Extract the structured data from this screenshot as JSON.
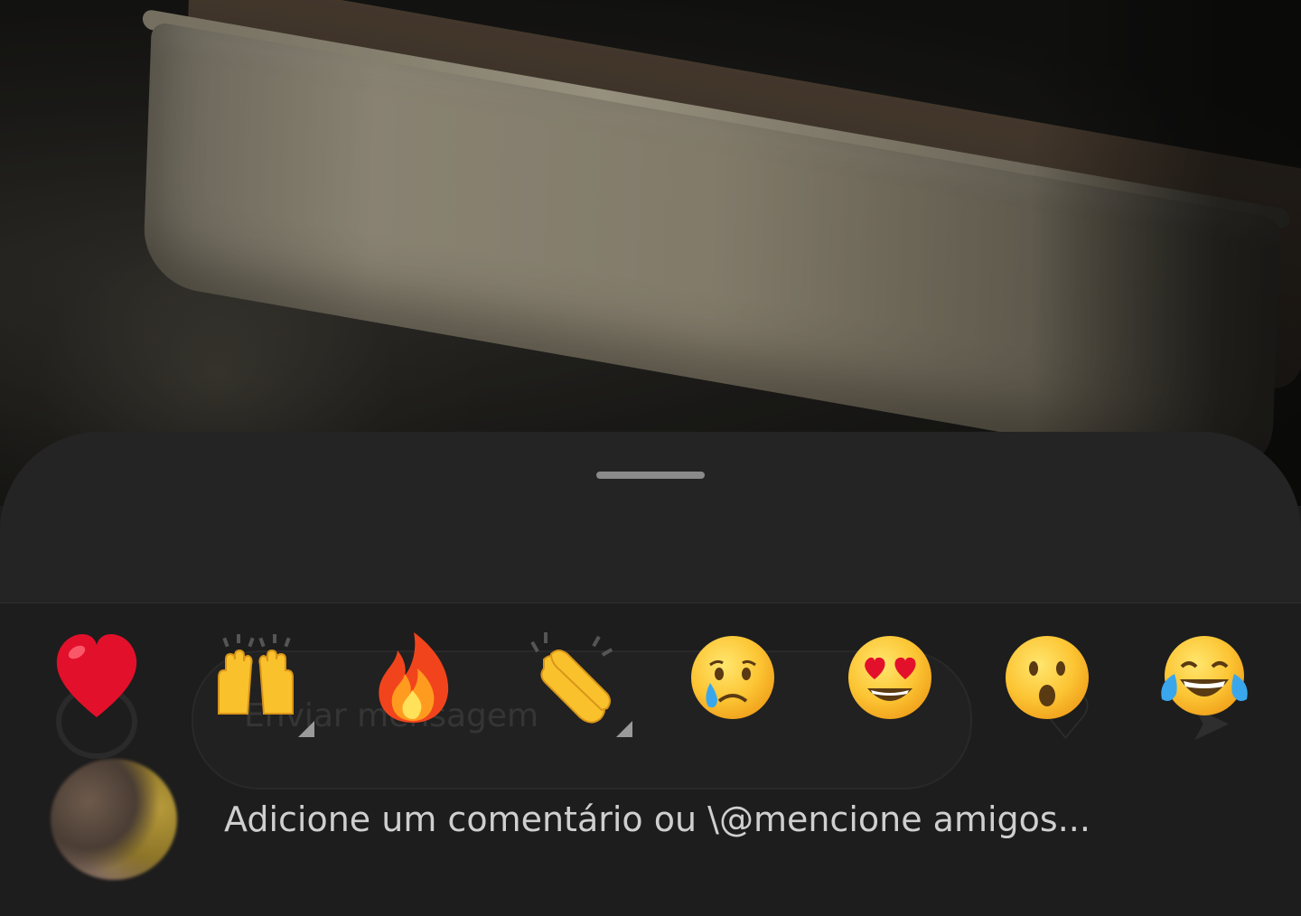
{
  "background": {
    "ghost_input_placeholder": "Enviar mensagem"
  },
  "reactions": [
    {
      "name": "heart",
      "glyph": "❤️"
    },
    {
      "name": "raising-hands",
      "glyph": "🙌"
    },
    {
      "name": "fire",
      "glyph": "🔥"
    },
    {
      "name": "clapping-hands",
      "glyph": "👏"
    },
    {
      "name": "crying-face",
      "glyph": "😢"
    },
    {
      "name": "heart-eyes",
      "glyph": "😍"
    },
    {
      "name": "surprised-face",
      "glyph": "😮"
    },
    {
      "name": "tears-of-joy",
      "glyph": "😂"
    }
  ],
  "comment": {
    "placeholder": "Adicione um comentário ou \\@mencione amigos..."
  },
  "colors": {
    "sheet_background": "#242424",
    "bottom_background": "#1d1d1d",
    "placeholder_text": "#cfcfcf",
    "grab_handle": "#8a8a8a"
  }
}
